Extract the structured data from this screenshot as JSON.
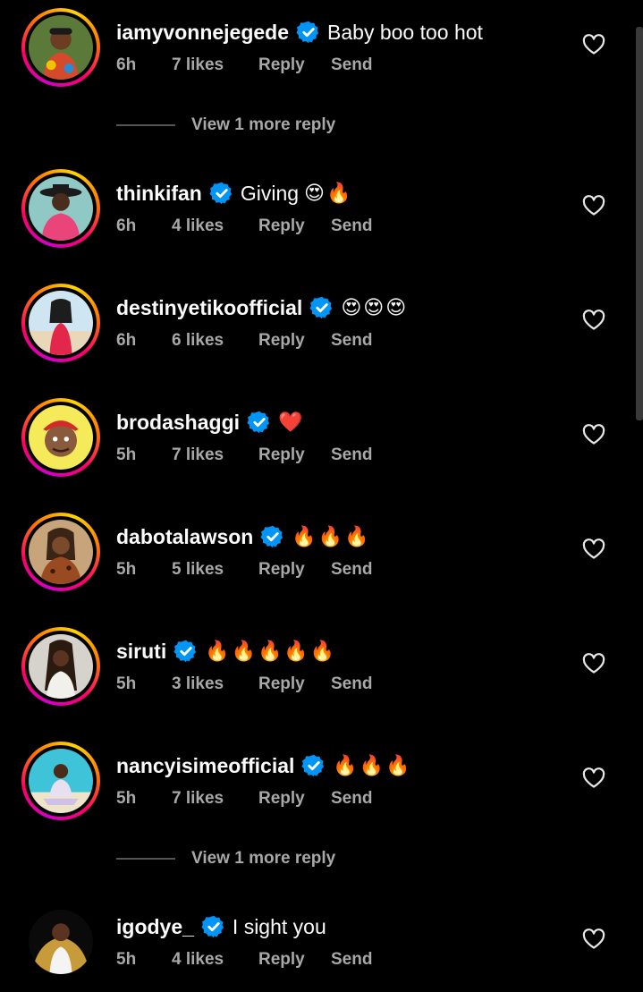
{
  "comments": [
    {
      "username": "iamyvonnejegede",
      "text": "Baby boo too hot",
      "emoji": "",
      "time": "6h",
      "likes": "7 likes",
      "reply": "Reply",
      "send": "Send"
    },
    {
      "username": "thinkifan",
      "text": "Giving",
      "emoji": "😍🔥",
      "time": "6h",
      "likes": "4 likes",
      "reply": "Reply",
      "send": "Send"
    },
    {
      "username": "destinyetikoofficial",
      "text": "",
      "emoji": "😍😍😍",
      "time": "6h",
      "likes": "6 likes",
      "reply": "Reply",
      "send": "Send"
    },
    {
      "username": "brodashaggi",
      "text": "",
      "emoji": "❤️",
      "time": "5h",
      "likes": "7 likes",
      "reply": "Reply",
      "send": "Send"
    },
    {
      "username": "dabotalawson",
      "text": "",
      "emoji": "🔥🔥🔥",
      "time": "5h",
      "likes": "5 likes",
      "reply": "Reply",
      "send": "Send"
    },
    {
      "username": "siruti",
      "text": "",
      "emoji": "🔥🔥🔥🔥🔥",
      "time": "5h",
      "likes": "3 likes",
      "reply": "Reply",
      "send": "Send"
    },
    {
      "username": "nancyisimeofficial",
      "text": "",
      "emoji": "🔥🔥🔥",
      "time": "5h",
      "likes": "7 likes",
      "reply": "Reply",
      "send": "Send"
    },
    {
      "username": "igodye_",
      "text": "I sight you",
      "emoji": "",
      "time": "5h",
      "likes": "4 likes",
      "reply": "Reply",
      "send": "Send"
    }
  ],
  "view_more_replies": [
    "View 1 more reply",
    "View 1 more reply"
  ],
  "icons": {
    "verified": "verified-badge-icon",
    "like": "heart-outline-icon"
  },
  "colors": {
    "background": "#000000",
    "verified": "#0095f6",
    "meta_text": "#a8a8a8"
  }
}
